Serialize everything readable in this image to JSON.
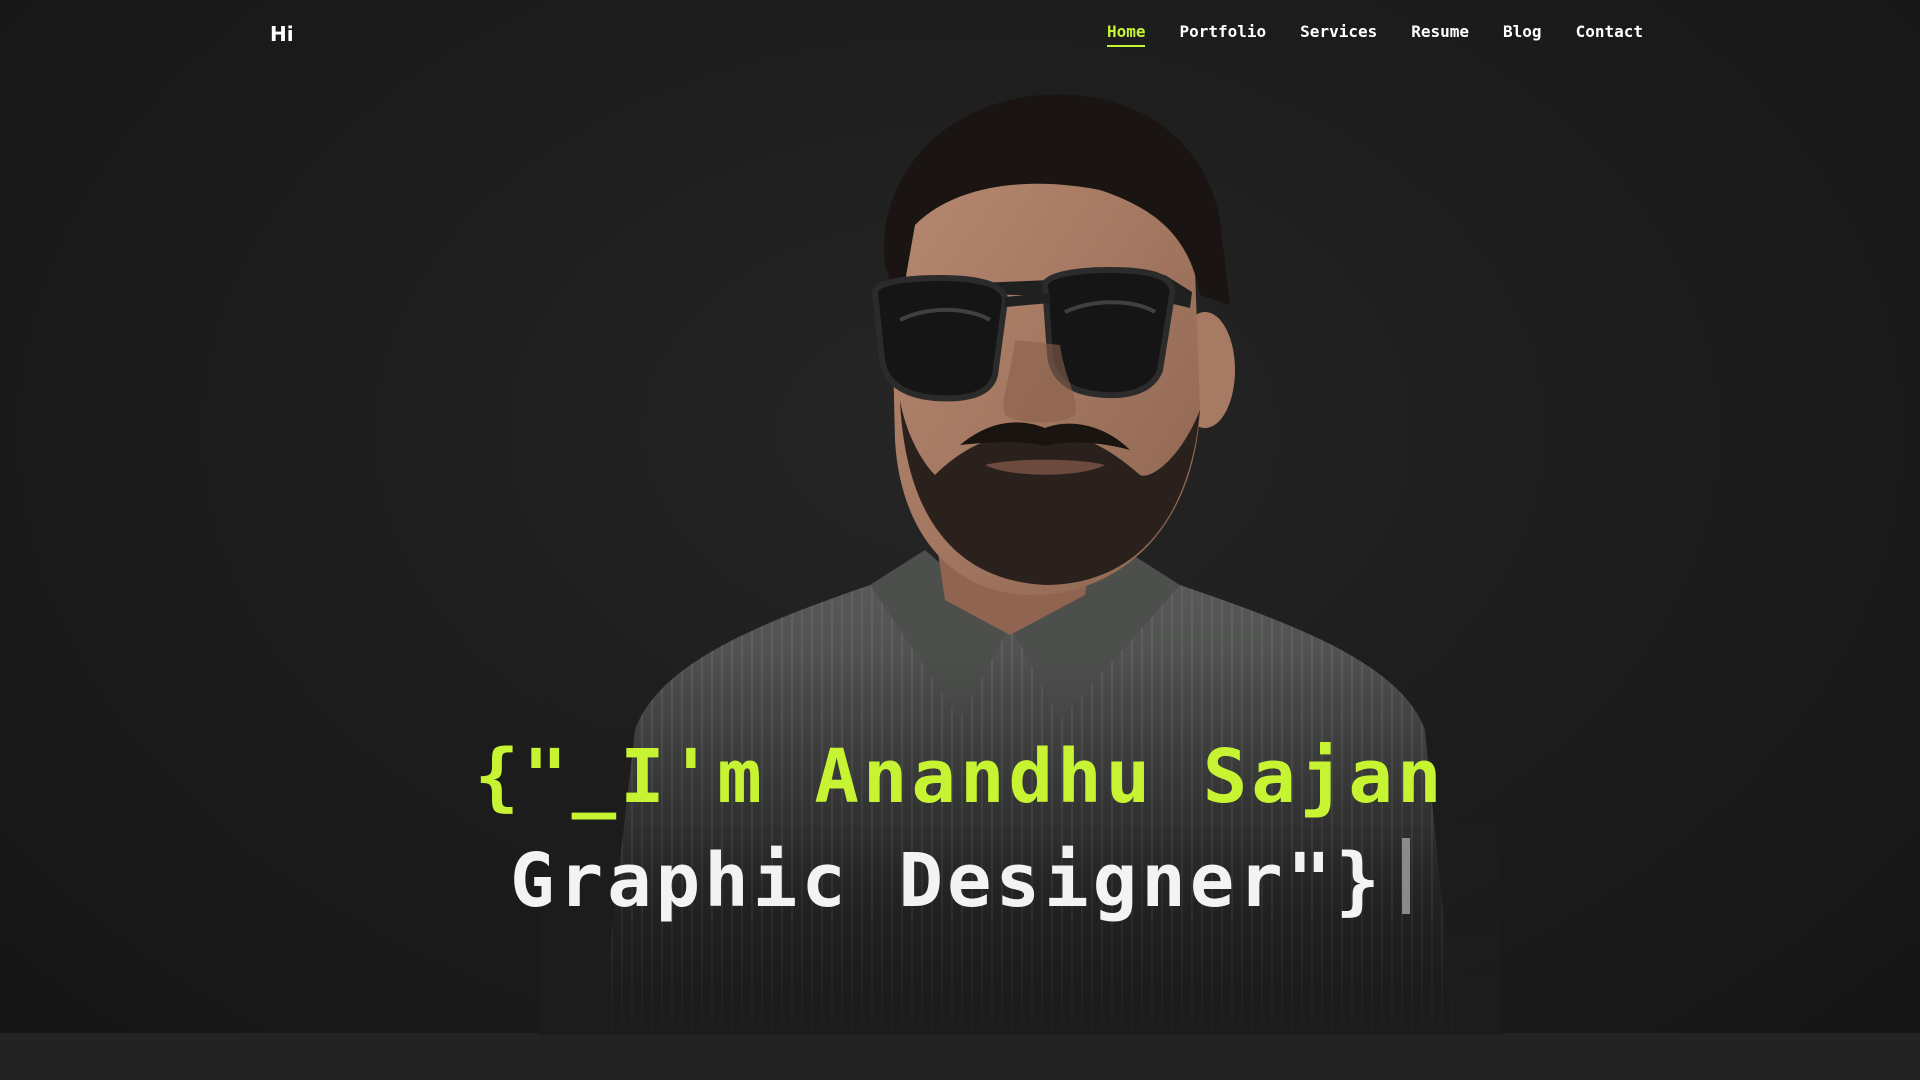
{
  "header": {
    "logo": "Hi",
    "nav": [
      {
        "label": "Home",
        "active": true
      },
      {
        "label": "Portfolio",
        "active": false
      },
      {
        "label": "Services",
        "active": false
      },
      {
        "label": "Resume",
        "active": false
      },
      {
        "label": "Blog",
        "active": false
      },
      {
        "label": "Contact",
        "active": false
      }
    ]
  },
  "hero": {
    "line1": "{\"_I'm Anandhu Sajan",
    "line2": "Graphic Designer\"}"
  },
  "colors": {
    "accent": "#c6f432",
    "background": "#1b1b1b",
    "text": "#ffffff"
  },
  "icons": {
    "cursor": "text-cursor-icon"
  }
}
